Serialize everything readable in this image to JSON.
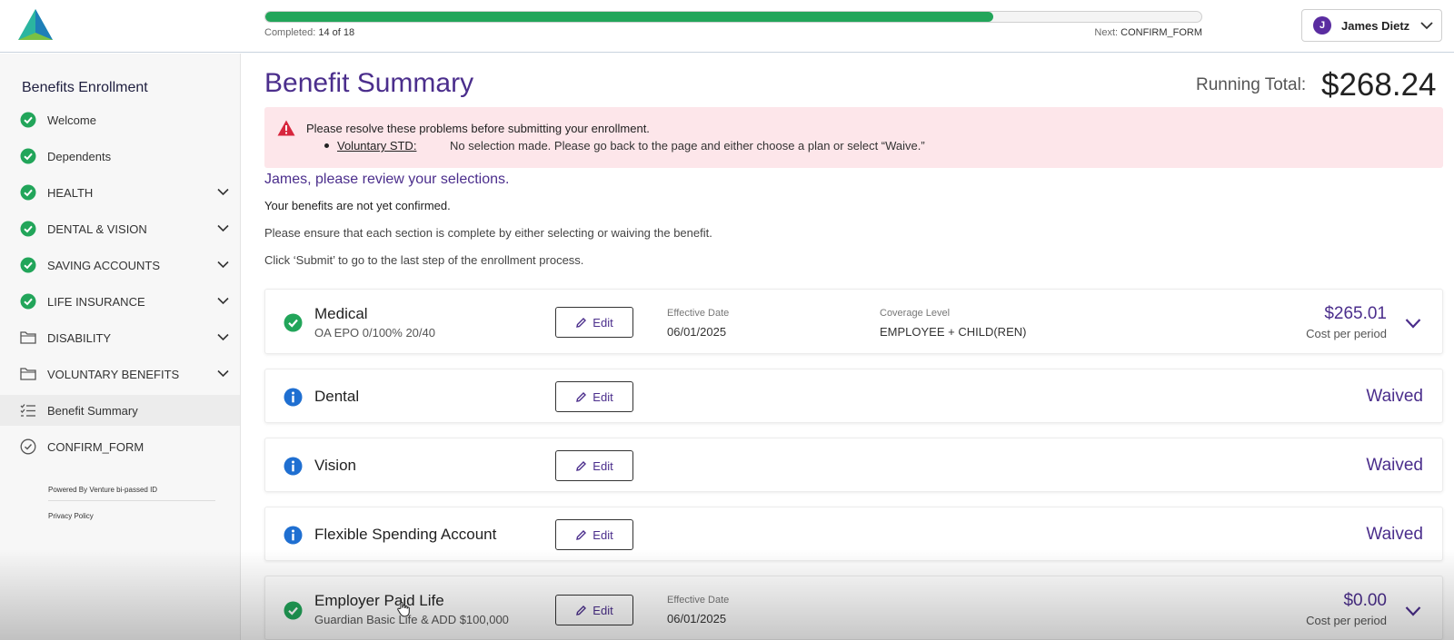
{
  "header": {
    "progress": {
      "completed_label": "Completed:",
      "completed_value": "14 of 18",
      "fraction": 0.7778,
      "next_label": "Next:",
      "next_value": "CONFIRM_FORM"
    },
    "user": {
      "initial": "J",
      "name": "James Dietz"
    }
  },
  "sidebar": {
    "title": "Benefits Enrollment",
    "items": [
      {
        "label": "Welcome",
        "icon": "check-circle-icon"
      },
      {
        "label": "Dependents",
        "icon": "check-circle-icon"
      },
      {
        "label": "HEALTH",
        "icon": "check-circle-icon"
      },
      {
        "label": "DENTAL & VISION",
        "icon": "check-circle-icon"
      },
      {
        "label": "SAVING ACCOUNTS",
        "icon": "check-circle-icon"
      },
      {
        "label": "LIFE INSURANCE",
        "icon": "check-circle-icon"
      },
      {
        "label": "DISABILITY",
        "icon": "folder-icon"
      },
      {
        "label": "VOLUNTARY BENEFITS",
        "icon": "folder-icon"
      },
      {
        "label": "Benefit Summary",
        "icon": "list-check-icon"
      },
      {
        "label": "CONFIRM_FORM",
        "icon": "circle-check-outline-icon"
      }
    ],
    "powered_by": "Powered By Venture  bi-passed ID",
    "privacy": "Privacy Policy"
  },
  "main": {
    "title": "Benefit Summary",
    "running_total_label": "Running Total:",
    "running_total_value": "$268.24",
    "alert": {
      "title": "Please resolve these problems before submitting your enrollment.",
      "item_link": "Voluntary STD:",
      "item_message": "No selection made. Please go back to the page and either choose a plan or select “Waive.”"
    },
    "review_heading": "James, please review your selections.",
    "not_confirmed": "Your benefits are not yet confirmed.",
    "instruction_1": "Please ensure that each section is complete by either selecting or waiving the benefit.",
    "instruction_2": "Click ‘Submit’ to go to the last step of the enrollment process.",
    "edit_label": "Edit",
    "effective_date_label": "Effective Date",
    "coverage_level_label": "Coverage Level",
    "cost_per_period_label": "Cost per period",
    "waived_label": "Waived",
    "cards": [
      {
        "name": "Medical",
        "plan": "OA EPO 0/100% 20/40",
        "effective_date": "06/01/2025",
        "coverage_level": "EMPLOYEE + CHILD(REN)",
        "cost": "$265.01",
        "status_icon": "check-circle-icon"
      },
      {
        "name": "Dental",
        "status_icon": "info-circle-icon"
      },
      {
        "name": "Vision",
        "status_icon": "info-circle-icon"
      },
      {
        "name": "Flexible Spending Account",
        "status_icon": "info-circle-icon"
      },
      {
        "name": "Employer Paid Life",
        "plan": "Guardian Basic Life & ADD $100,000",
        "effective_date": "06/01/2025",
        "cost": "$0.00",
        "status_icon": "check-circle-icon"
      }
    ]
  },
  "colors": {
    "brand_purple": "#4b2e8c",
    "success_green": "#22a55a",
    "info_blue": "#1f6fd1",
    "alert_bg": "#fde6ea",
    "alert_red": "#d7263d"
  }
}
